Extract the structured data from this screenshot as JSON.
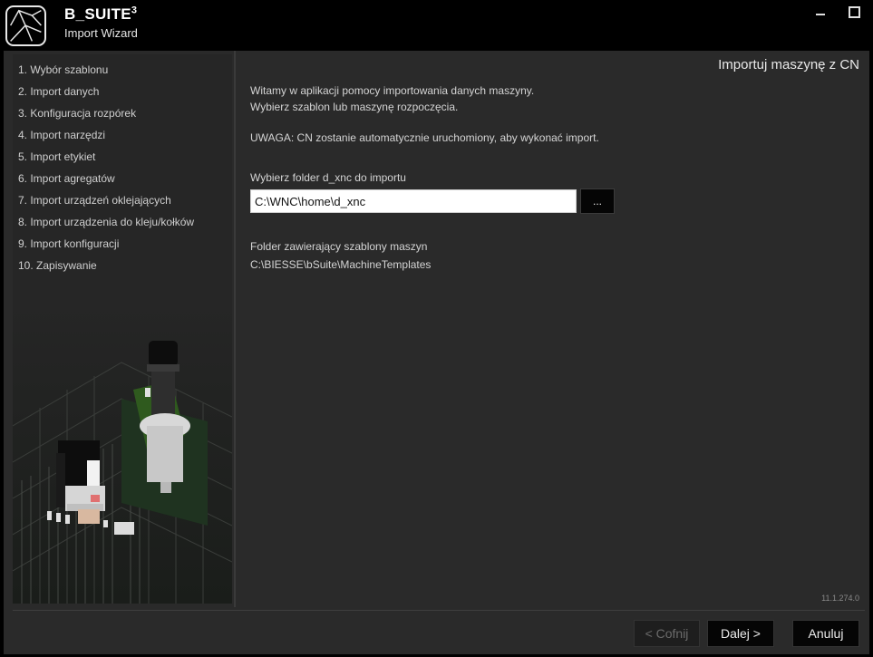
{
  "app": {
    "brand": "B_SUITE",
    "brand_sup": "3",
    "subtitle": "Import Wizard"
  },
  "window_controls": {
    "minimize_icon": "minimize-icon",
    "maximize_icon": "maximize-icon"
  },
  "sidebar": {
    "steps": [
      "1. Wybór szablonu",
      "2. Import danych",
      "3. Konfiguracja rozpórek",
      "4. Import narzędzi",
      "5. Import etykiet",
      "6. Import agregatów",
      "7. Import urządzeń oklejających",
      "8. Import urządzenia do kleju/kołków",
      "9. Import konfiguracji",
      "10. Zapisywanie"
    ]
  },
  "main": {
    "title": "Importuj maszynę z CN",
    "intro_line1": "Witamy w aplikacji pomocy importowania danych maszyny.",
    "intro_line2": "Wybierz szablon lub maszynę rozpoczęcia.",
    "warning": "UWAGA: CN zostanie automatycznie uruchomiony, aby wykonać import.",
    "folder_label": "Wybierz folder d_xnc do importu",
    "folder_value": "C:\\WNC\\home\\d_xnc",
    "browse_label": "...",
    "templates_label": "Folder zawierający szablony maszyn",
    "templates_path": "C:\\BIESSE\\bSuite\\MachineTemplates",
    "version": "11.1.274.0"
  },
  "footer": {
    "back_label": "< Cofnij",
    "next_label": "Dalej >",
    "cancel_label": "Anuluj"
  },
  "colors": {
    "background": "#2a2a2a",
    "titlebar": "#000000",
    "input_bg": "#ffffff",
    "button_bg": "#050505",
    "disabled_text": "#6b6b6b"
  }
}
